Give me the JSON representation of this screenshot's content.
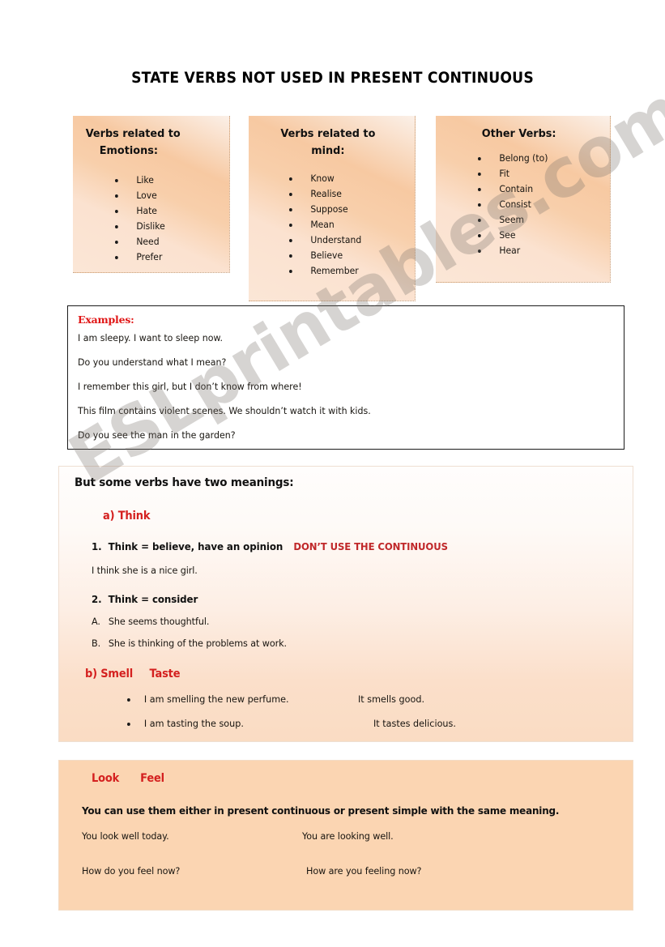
{
  "watermark": {
    "text": "ESLprintables.com"
  },
  "title": "STATE VERBS NOT USED IN PRESENT CONTINUOUS",
  "verb_boxes": [
    {
      "id": "emotions",
      "title_line1": "Verbs related to",
      "title_line2": "Emotions:",
      "items": [
        "Like",
        "Love",
        "Hate",
        "Dislike",
        "Need",
        "Prefer"
      ]
    },
    {
      "id": "mind",
      "title_line1": "Verbs related to",
      "title_line2": "mind:",
      "items": [
        "Know",
        "Realise",
        "Suppose",
        "Mean",
        "Understand",
        "Believe",
        "Remember"
      ]
    },
    {
      "id": "other",
      "title_line1": "Other Verbs:",
      "title_line2": "",
      "items": [
        "Belong (to)",
        "Fit",
        "Contain",
        "Consist",
        "Seem",
        "See",
        "Hear"
      ]
    }
  ],
  "examples": {
    "heading": "Examples:",
    "lines": [
      "I am sleepy. I want to sleep now.",
      "Do you understand what I mean?",
      "I remember this girl, but I don’t know from where!",
      "This film contains violent scenes. We shouldn’t watch it with kids.",
      "Do you see the man in the garden?"
    ]
  },
  "meanings": {
    "heading": "But some verbs have two meanings:",
    "think_label": "a) Think",
    "item1_marker": "1.",
    "item1_text": "Think = believe, have an opinion",
    "item1_warning": "DON’T USE THE CONTINUOUS",
    "item1_example": "I think she is a nice girl.",
    "item2_marker": "2.",
    "item2_text": "Think = consider",
    "item_a_marker": "A.",
    "item_a_text": "She seems thoughtful.",
    "item_b_marker": "B.",
    "item_b_text": "She is thinking of the problems at work.",
    "smell_label_1": "b) Smell",
    "smell_label_2": "Taste",
    "smell_rows": [
      {
        "left": "I am smelling the new perfume.",
        "right": "It smells good."
      },
      {
        "left": "I am tasting the soup.",
        "right": "It tastes delicious."
      }
    ]
  },
  "lookfeel": {
    "label_1": "Look",
    "label_2": "Feel",
    "note": "You can use them either in present continuous or present simple with the same meaning.",
    "rows": [
      {
        "left": "You look well today.",
        "right": "You are looking well."
      },
      {
        "left": "How do you feel now?",
        "right": "How are you feeling now?"
      }
    ]
  },
  "colors": {
    "red_heading": "#d4201f",
    "red_examples": "#e01515",
    "red_warning": "#c0282a",
    "peach": "#fbd5b2",
    "peach_light": "#fadcc3"
  }
}
